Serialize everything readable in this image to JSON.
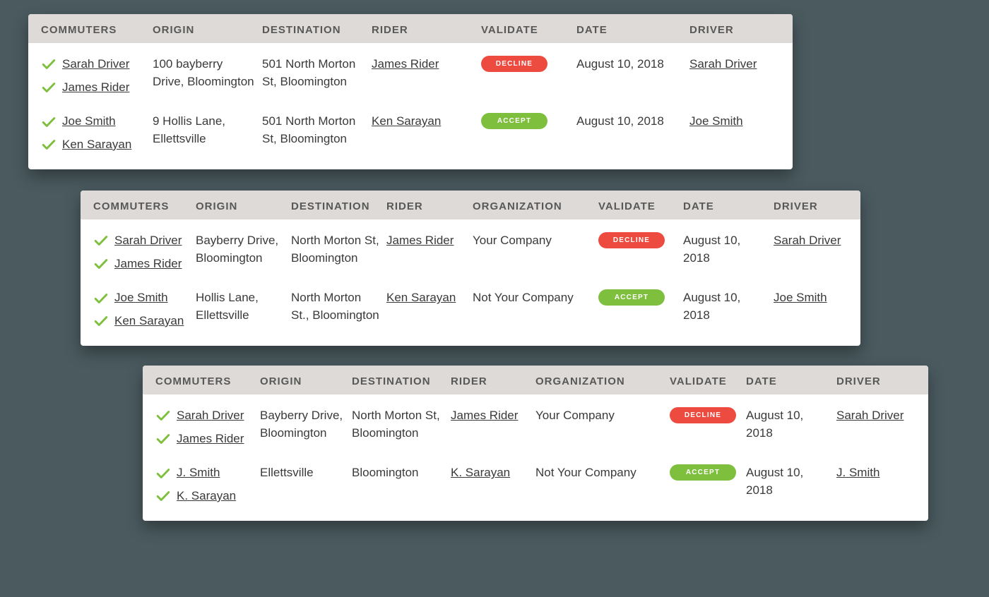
{
  "headers": {
    "commuters": "COMMUTERS",
    "origin": "ORIGIN",
    "destination": "DESTINATION",
    "rider": "RIDER",
    "organization": "ORGANIZATION",
    "validate": "VALIDATE",
    "date": "DATE",
    "driver": "DRIVER"
  },
  "labels": {
    "decline": "DECLINE",
    "accept": "ACCEPT"
  },
  "card1": {
    "rows": [
      {
        "commuters": [
          "Sarah Driver",
          "James Rider"
        ],
        "origin": "100 bayberry Drive, Bloomington",
        "destination": "501 North Morton St, Bloomington",
        "rider": "James Rider",
        "validate": "decline",
        "date": "August 10, 2018",
        "driver": "Sarah Driver"
      },
      {
        "commuters": [
          "Joe Smith",
          "Ken Sarayan"
        ],
        "origin": "9 Hollis Lane, Ellettsville",
        "destination": "501 North Morton St, Bloomington",
        "rider": "Ken Sarayan",
        "validate": "accept",
        "date": "August 10, 2018",
        "driver": "Joe Smith"
      }
    ]
  },
  "card2": {
    "rows": [
      {
        "commuters": [
          "Sarah Driver",
          "James Rider"
        ],
        "origin": "Bayberry Drive, Bloomington",
        "destination": "North Morton St, Bloomington",
        "rider": "James Rider",
        "organization": "Your Company",
        "validate": "decline",
        "date": "August 10, 2018",
        "driver": "Sarah Driver"
      },
      {
        "commuters": [
          "Joe Smith",
          "Ken Sarayan"
        ],
        "origin": "Hollis Lane, Ellettsville",
        "destination": "North Morton St., Bloomington",
        "rider": "Ken Sarayan",
        "organization": "Not Your Company",
        "validate": "accept",
        "date": "August 10, 2018",
        "driver": "Joe Smith"
      }
    ]
  },
  "card3": {
    "rows": [
      {
        "commuters": [
          "Sarah Driver",
          "James Rider"
        ],
        "origin": "Bayberry Drive, Bloomington",
        "destination": "North Morton St, Bloomington",
        "rider": "James Rider",
        "organization": "Your Company",
        "validate": "decline",
        "date": "August 10, 2018",
        "driver": "Sarah Driver"
      },
      {
        "commuters": [
          "J. Smith",
          "K. Sarayan"
        ],
        "origin": "Ellettsville",
        "destination": "Bloomington",
        "rider": "K. Sarayan",
        "organization": "Not Your Company",
        "validate": "accept",
        "date": "August 10, 2018",
        "driver": "J. Smith"
      }
    ]
  }
}
